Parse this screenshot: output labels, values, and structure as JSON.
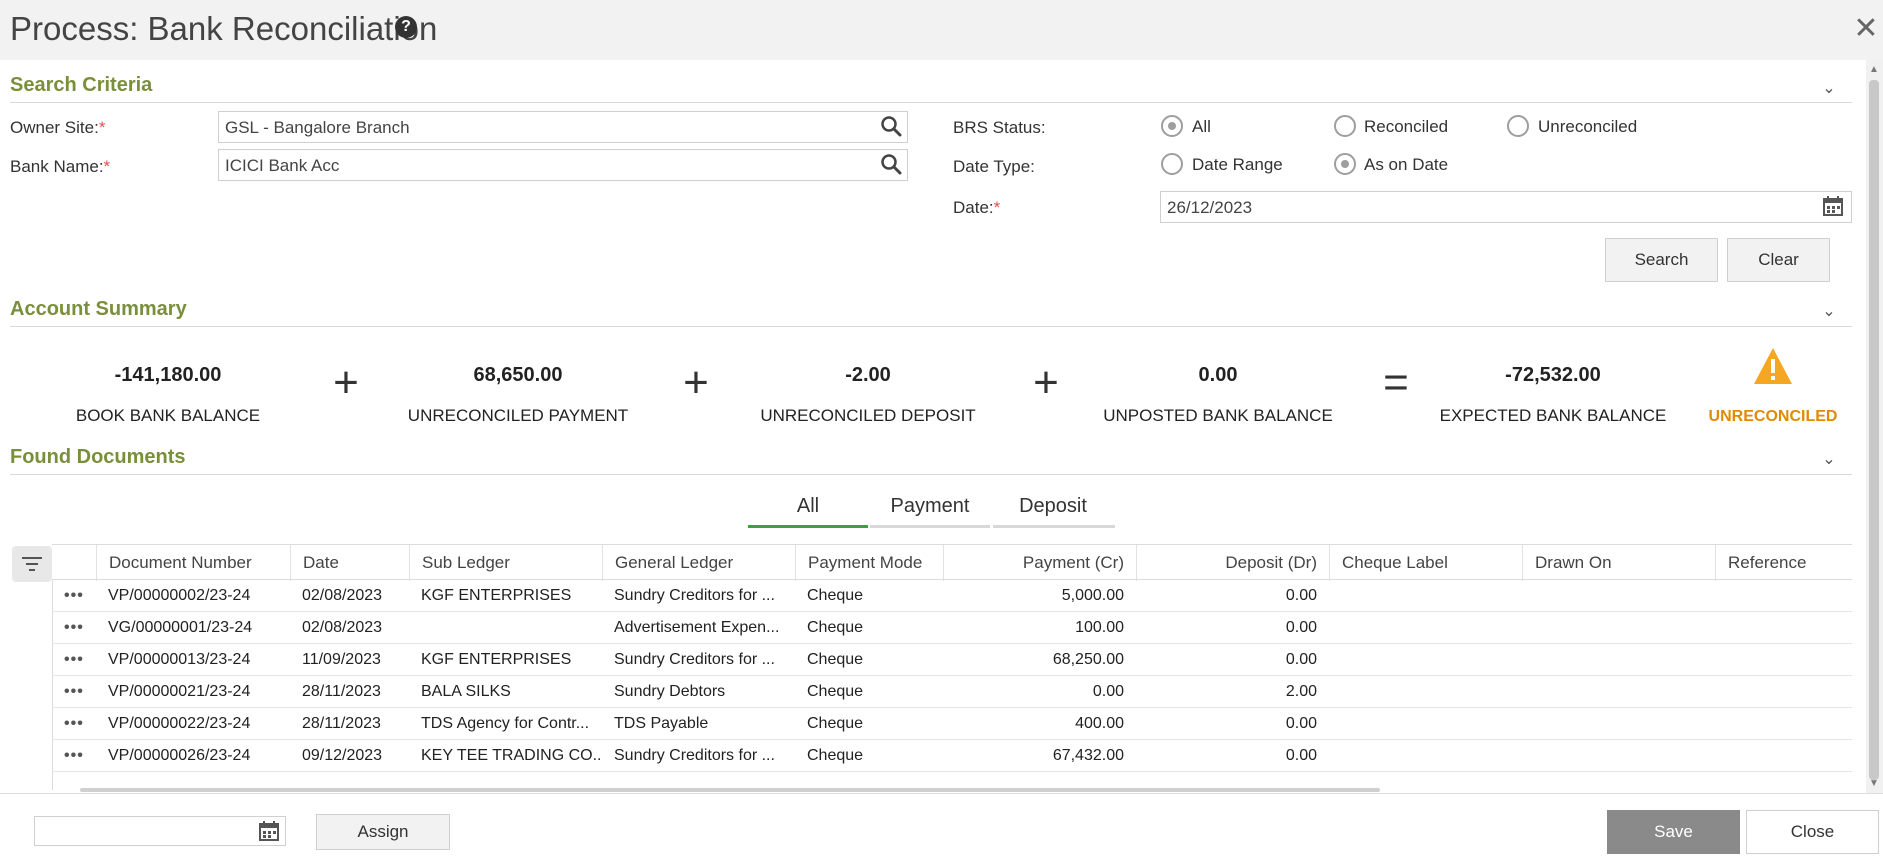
{
  "window": {
    "title": "Process: Bank Reconciliation",
    "help_icon": "question-circle-icon",
    "close_icon": "close-icon"
  },
  "search_criteria": {
    "title": "Search Criteria",
    "owner_site_label": "Owner Site:",
    "owner_site_value": "GSL - Bangalore Branch",
    "bank_name_label": "Bank Name:",
    "bank_name_value": "ICICI Bank Acc",
    "required_mark": "*",
    "brs_status_label": "BRS Status:",
    "brs_options": [
      "All",
      "Reconciled",
      "Unreconciled"
    ],
    "brs_selected": "All",
    "date_type_label": "Date Type:",
    "date_type_options": [
      "Date Range",
      "As on Date"
    ],
    "date_type_selected": "As on Date",
    "date_label": "Date:",
    "date_value": "26/12/2023",
    "search_button": "Search",
    "clear_button": "Clear"
  },
  "account_summary": {
    "title": "Account Summary",
    "items": [
      {
        "value": "-141,180.00",
        "label": "BOOK BANK BALANCE"
      },
      {
        "value": "68,650.00",
        "label": "UNRECONCILED PAYMENT"
      },
      {
        "value": "-2.00",
        "label": "UNRECONCILED DEPOSIT"
      },
      {
        "value": "0.00",
        "label": "UNPOSTED BANK BALANCE"
      },
      {
        "value": "-72,532.00",
        "label": "EXPECTED BANK BALANCE"
      }
    ],
    "operators": [
      "+",
      "+",
      "+",
      "="
    ],
    "status_label": "UNRECONCILED",
    "status_icon": "warning-triangle-icon",
    "status_color": "#e08a00"
  },
  "found_documents": {
    "title": "Found Documents",
    "tabs": [
      "All",
      "Payment",
      "Deposit"
    ],
    "active_tab": "All",
    "accent_color": "#3aa33a",
    "columns": [
      "Document Number",
      "Date",
      "Sub Ledger",
      "General Ledger",
      "Payment Mode",
      "Payment (Cr)",
      "Deposit (Dr)",
      "Cheque Label",
      "Drawn On",
      "Reference"
    ],
    "rows": [
      [
        "VP/00000002/23-24",
        "02/08/2023",
        "KGF ENTERPRISES",
        "Sundry Creditors for ...",
        "Cheque",
        "5,000.00",
        "0.00",
        "",
        "",
        ""
      ],
      [
        "VG/00000001/23-24",
        "02/08/2023",
        "",
        "Advertisement Expen...",
        "Cheque",
        "100.00",
        "0.00",
        "",
        "",
        ""
      ],
      [
        "VP/00000013/23-24",
        "11/09/2023",
        "KGF ENTERPRISES",
        "Sundry Creditors for ...",
        "Cheque",
        "68,250.00",
        "0.00",
        "",
        "",
        ""
      ],
      [
        "VP/00000021/23-24",
        "28/11/2023",
        "BALA SILKS",
        "Sundry Debtors",
        "Cheque",
        "0.00",
        "2.00",
        "",
        "",
        ""
      ],
      [
        "VP/00000022/23-24",
        "28/11/2023",
        "TDS Agency for Contr...",
        "TDS Payable",
        "Cheque",
        "400.00",
        "0.00",
        "",
        "",
        ""
      ],
      [
        "VP/00000026/23-24",
        "09/12/2023",
        "KEY TEE TRADING CO...",
        "Sundry Creditors for ...",
        "Cheque",
        "67,432.00",
        "0.00",
        "",
        "",
        ""
      ]
    ],
    "row_menu": "•••"
  },
  "footer": {
    "assign_button": "Assign",
    "save_button": "Save",
    "close_button": "Close"
  }
}
